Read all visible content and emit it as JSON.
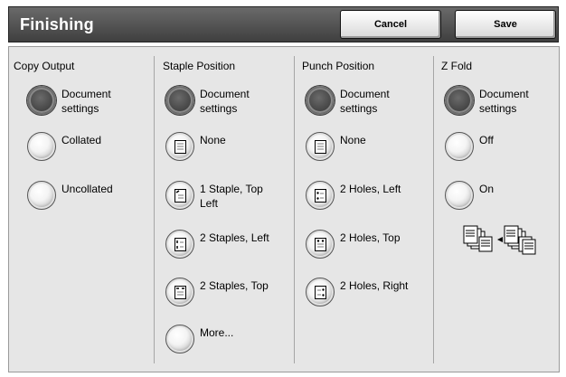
{
  "header": {
    "title": "Finishing",
    "cancel_label": "Cancel",
    "save_label": "Save"
  },
  "columns": {
    "copy_output": {
      "heading": "Copy Output",
      "options": [
        {
          "label": "Document settings",
          "selected": true
        },
        {
          "label": "Collated",
          "selected": false
        },
        {
          "label": "Uncollated",
          "selected": false
        }
      ]
    },
    "staple_position": {
      "heading": "Staple Position",
      "options": [
        {
          "label": "Document settings",
          "selected": true,
          "icon": "none"
        },
        {
          "label": "None",
          "selected": false,
          "icon": "page-blank-icon"
        },
        {
          "label": "1 Staple, Top Left",
          "selected": false,
          "icon": "staple-top-left-icon"
        },
        {
          "label": "2 Staples, Left",
          "selected": false,
          "icon": "staple-left-icon"
        },
        {
          "label": "2 Staples, Top",
          "selected": false,
          "icon": "staple-top-icon"
        },
        {
          "label": "More...",
          "selected": false,
          "icon": "none"
        }
      ]
    },
    "punch_position": {
      "heading": "Punch Position",
      "options": [
        {
          "label": "Document settings",
          "selected": true,
          "icon": "none"
        },
        {
          "label": "None",
          "selected": false,
          "icon": "page-blank-icon"
        },
        {
          "label": "2 Holes, Left",
          "selected": false,
          "icon": "punch-left-icon"
        },
        {
          "label": "2 Holes, Top",
          "selected": false,
          "icon": "punch-top-icon"
        },
        {
          "label": "2 Holes, Right",
          "selected": false,
          "icon": "punch-right-icon"
        }
      ]
    },
    "z_fold": {
      "heading": "Z Fold",
      "options": [
        {
          "label": "Document settings",
          "selected": true
        },
        {
          "label": "Off",
          "selected": false
        },
        {
          "label": "On",
          "selected": false
        }
      ],
      "illustration_icon": "z-fold-illustration-icon"
    }
  }
}
